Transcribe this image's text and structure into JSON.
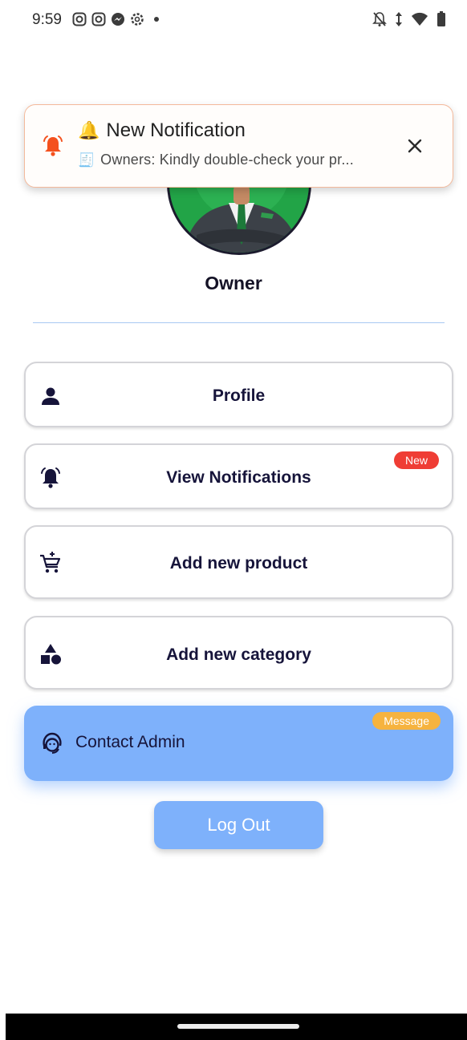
{
  "status_bar": {
    "time": "9:59",
    "left_icons": [
      "instagram-icon",
      "instagram-icon",
      "messenger-icon",
      "settings-cog-icon",
      "dot-icon"
    ],
    "right_icons": [
      "notifications-off-icon",
      "data-arrows-icon",
      "wifi-icon",
      "battery-icon"
    ]
  },
  "profile": {
    "name": "Owner"
  },
  "notification_toast": {
    "title_emoji": "🔔",
    "title": "New Notification",
    "body_emoji": "🧾",
    "body": "Owners: Kindly double-check your pr...",
    "accent_color": "#f4511e"
  },
  "menu": {
    "items": [
      {
        "label": "Profile",
        "icon": "person-icon"
      },
      {
        "label": "View Notifications",
        "icon": "ringing-bell-icon",
        "badge": "New"
      },
      {
        "label": "Add new product",
        "icon": "cart-add-icon"
      },
      {
        "label": "Add new category",
        "icon": "shapes-icon"
      }
    ]
  },
  "contact": {
    "label": "Contact Admin",
    "icon": "support-agent-icon",
    "badge": "Message"
  },
  "logout": {
    "label": "Log Out"
  },
  "colors": {
    "primary": "#7eb1fb",
    "badge_new": "#ef3d35",
    "badge_message": "#f6b33f",
    "text_dark": "#16143a"
  }
}
